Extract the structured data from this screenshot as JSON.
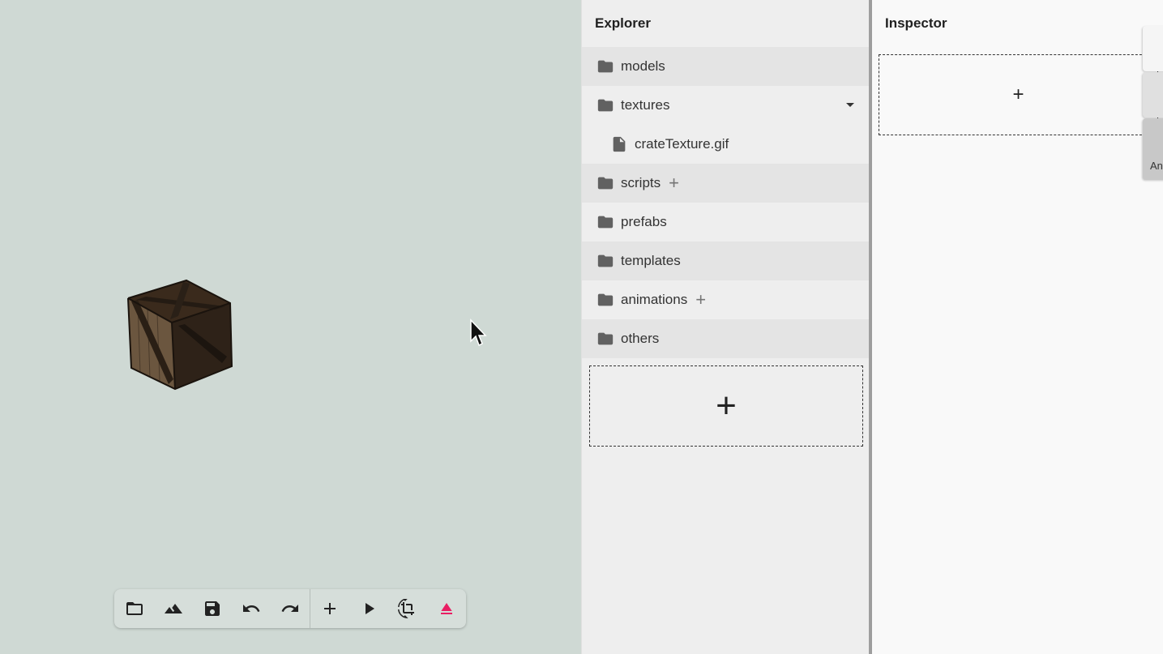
{
  "explorer": {
    "title": "Explorer",
    "items": [
      {
        "label": "models",
        "type": "folder"
      },
      {
        "label": "textures",
        "type": "folder",
        "expanded": true
      },
      {
        "label": "crateTexture.gif",
        "type": "file"
      },
      {
        "label": "scripts",
        "type": "folder",
        "add": "+"
      },
      {
        "label": "prefabs",
        "type": "folder"
      },
      {
        "label": "templates",
        "type": "folder"
      },
      {
        "label": "animations",
        "type": "folder",
        "add": "+"
      },
      {
        "label": "others",
        "type": "folder"
      }
    ],
    "dropzone_label": "+"
  },
  "inspector": {
    "title": "Inspector",
    "dropzone_label": "+"
  },
  "side_tabs": {
    "tab3_label": "An"
  },
  "toolbar": {
    "buttons": [
      "folder-icon",
      "terrain-icon",
      "save-icon",
      "undo-icon",
      "redo-icon",
      "add-icon",
      "play-icon",
      "crop-rotate-icon",
      "eject-icon"
    ]
  },
  "colors": {
    "viewport_bg": "#cfd9d4",
    "eject": "#e91e63"
  }
}
